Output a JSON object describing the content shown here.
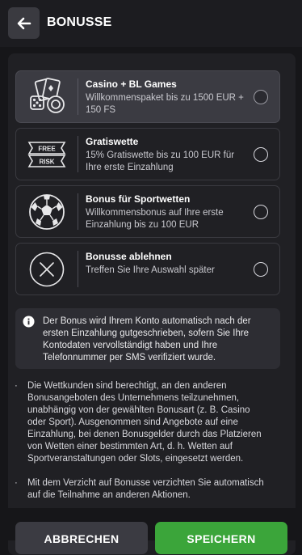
{
  "header": {
    "title": "BONUSSE",
    "back_icon": "arrow-left-icon"
  },
  "options": [
    {
      "title": "Casino + BL Games",
      "description": "Willkommenspaket bis zu 1500 EUR + 150 FS",
      "icon": "casino-cards-dice-icon",
      "selected": true
    },
    {
      "title": "Gratiswette",
      "description": "15% Gratiswette bis zu 100 EUR für Ihre erste Einzahlung",
      "icon": "free-risk-ticket-icon",
      "selected": false,
      "icon_text_top": "FREE",
      "icon_text_bottom": "RISK"
    },
    {
      "title": "Bonus für Sportwetten",
      "description": "Willkommensbonus auf Ihre erste Einzahlung bis zu 100 EUR",
      "icon": "soccer-ball-icon",
      "selected": false
    },
    {
      "title": "Bonusse ablehnen",
      "description": "Treffen Sie Ihre Auswahl später",
      "icon": "decline-x-circle-icon",
      "selected": false
    }
  ],
  "info": {
    "text": "Der Bonus wird Ihrem Konto automatisch nach der ersten Einzahlung gutgeschrieben, sofern Sie Ihre Kontodaten vervollständigt haben und Ihre Telefonnummer per SMS verifiziert wurde."
  },
  "bullets": [
    "Die Wettkunden sind berechtigt, an den anderen Bonusangeboten des Unternehmens teilzunehmen, unabhängig von der gewählten Bonusart (z. B. Casino oder Sport). Ausgenommen sind Angebote auf eine Einzahlung, bei denen Bonusgelder durch das Platzieren von Wetten einer bestimmten Art, d. h. Wetten auf Sportveranstaltungen oder Slots, eingesetzt werden.",
    "Mit dem Verzicht auf Bonusse verzichten Sie automatisch auf die Teilnahme an anderen Aktionen."
  ],
  "bullet_mark": "·",
  "buttons": {
    "cancel": "ABBRECHEN",
    "save": "SPEICHERN"
  },
  "colors": {
    "accent_green": "#3ba53a",
    "background": "#161619",
    "panel": "#202024",
    "selected_option": "#3b3b42"
  }
}
